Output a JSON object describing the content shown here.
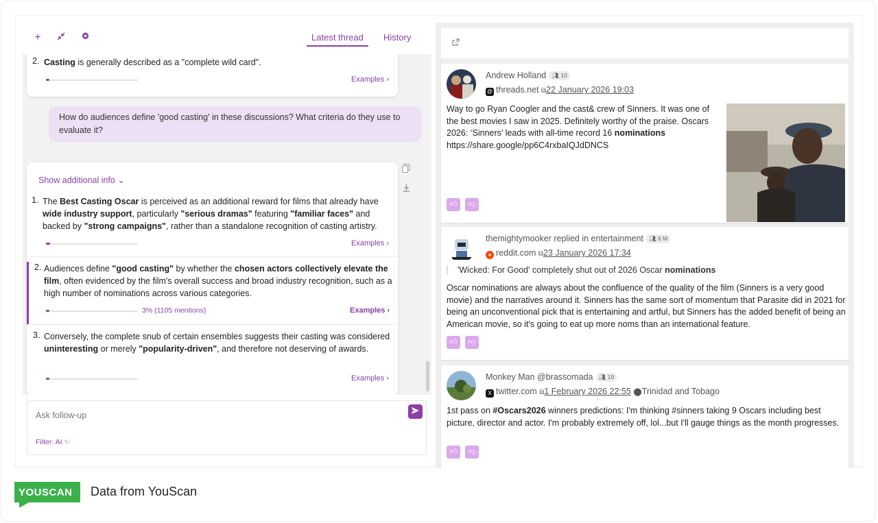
{
  "header": {
    "tabs": [
      {
        "label": "Latest thread",
        "active": true
      },
      {
        "label": "History",
        "active": false
      }
    ],
    "icons": [
      "plus-icon",
      "collapse-icon",
      "gear-icon"
    ]
  },
  "chat": {
    "prev_item": {
      "number": "2.",
      "bold": "Casting",
      "text": " is generally described as a \"complete wild card\".",
      "examples_label": "Examples",
      "progress": 0.03
    },
    "user_question": "How do audiences define 'good casting' in these discussions? What criteria do they use to evaluate it?",
    "answer": {
      "show_info_label": "Show additional info",
      "items": [
        {
          "number": "1.",
          "segments": [
            {
              "t": "The ",
              "b": false
            },
            {
              "t": "Best Casting Oscar",
              "b": true
            },
            {
              "t": " is perceived as an additional reward for films that already have ",
              "b": false
            },
            {
              "t": "wide industry support",
              "b": true
            },
            {
              "t": ", particularly ",
              "b": false
            },
            {
              "t": "\"serious dramas\"",
              "b": true
            },
            {
              "t": " featuring ",
              "b": false
            },
            {
              "t": "\"familiar faces\"",
              "b": true
            },
            {
              "t": " and backed by ",
              "b": false
            },
            {
              "t": "\"strong campaigns\"",
              "b": true
            },
            {
              "t": ", rather than a standalone recognition of casting artistry.",
              "b": false
            }
          ],
          "examples_label": "Examples",
          "progress": 0.03
        },
        {
          "number": "2.",
          "segments": [
            {
              "t": "Audiences define ",
              "b": false
            },
            {
              "t": "\"good casting\"",
              "b": true
            },
            {
              "t": " by whether the ",
              "b": false
            },
            {
              "t": "chosen actors collectively elevate the film",
              "b": true
            },
            {
              "t": ", often evidenced by the film's overall success and broad industry recognition, such as a high number of nominations across various categories.",
              "b": false
            }
          ],
          "mentions": "3% (1105 mentions)",
          "examples_label": "Examples",
          "progress": 0.03,
          "selected": true
        },
        {
          "number": "3.",
          "segments": [
            {
              "t": "Conversely, the complete snub of certain ensembles suggests their casting was considered ",
              "b": false
            },
            {
              "t": "uninteresting",
              "b": true
            },
            {
              "t": " or merely ",
              "b": false
            },
            {
              "t": "\"popularity-driven\"",
              "b": true
            },
            {
              "t": ", and therefore not deserving of awards.",
              "b": false
            }
          ],
          "examples_label": "Examples",
          "progress": 0.03
        }
      ]
    },
    "input": {
      "placeholder": "Ask follow-up",
      "filter_label": "Filter: AI"
    }
  },
  "posts": [
    {
      "author": "Andrew Holland",
      "badge": "10",
      "source": "threads.net",
      "date": "22 January 2026 19:03",
      "text": [
        {
          "t": "Way to go Ryan Coogler and the cast& crew of Sinners. It was one of the best movies I saw in 2025. Definitely worthy of the praise. Oscars 2026: ‘Sinners’ leads with all-time record 16 ",
          "b": false
        },
        {
          "t": "nominations",
          "b": true
        },
        {
          "t": " https://share.google/pp6C4rxbaIQJdDNCS",
          "b": false
        }
      ]
    },
    {
      "author": "themightymooker",
      "replied": " replied in entertainment",
      "badge": "6 M",
      "source": "reddit.com",
      "date": "23 January 2026 17:34",
      "quote": [
        {
          "t": "'Wicked: For Good' completely shut out of 2026 Oscar ",
          "b": false
        },
        {
          "t": "nominations",
          "b": true
        }
      ],
      "text": [
        {
          "t": "Oscar nominations are always about the confluence of the quality of the film (Sinners is a very good movie) and the narratives around it. Sinners has the same sort of momentum that Parasite did in 2021 for being an unconventional pick that is entertaining and artful, but Sinners has the added benefit of being an American movie, so it's going to eat up more noms than an international feature.",
          "b": false
        }
      ]
    },
    {
      "author": "Monkey Man @brassomada",
      "badge": "19",
      "source": "twitter.com",
      "date": "1 February 2026 22:55",
      "location": "Trinidad and Tobago",
      "text": [
        {
          "t": "1st pass on ",
          "b": false
        },
        {
          "t": "#Oscars2026",
          "b": true
        },
        {
          "t": " winners predictions: I'm thinking #sinners taking 9 Oscars including best picture, director and actor. I'm probably extremely off, lol...but I'll gauge things as the month progresses.",
          "b": false
        }
      ]
    }
  ],
  "footer": {
    "logo": "YOUSCAN",
    "text": "Data from YouScan"
  },
  "colors": {
    "accent": "#8b3fa8",
    "bubble": "#ece0f4",
    "logo_green": "#3cb14a"
  }
}
